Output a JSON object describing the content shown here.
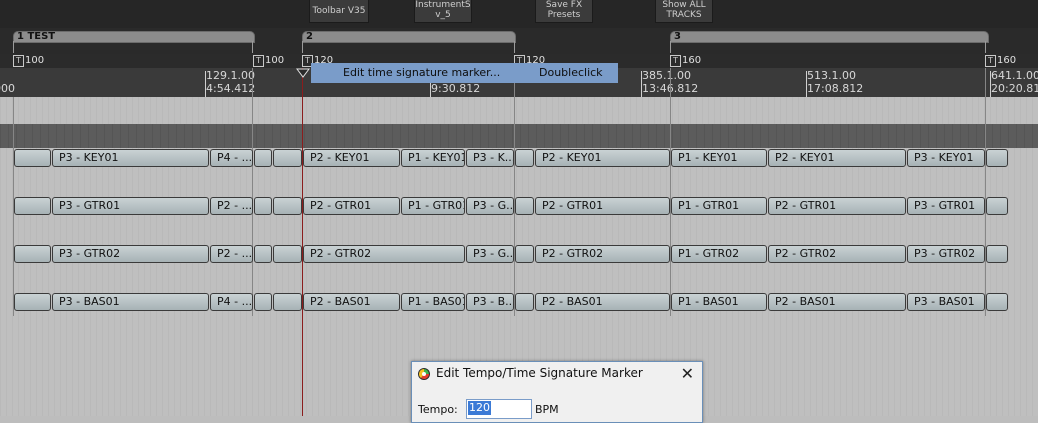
{
  "toolbar": {
    "buttons": [
      {
        "label": "Toolbar V35"
      },
      {
        "label": "InstrumentS v_5"
      },
      {
        "label": "Save FX Presets"
      },
      {
        "label": "Show ALL TRACKS"
      }
    ]
  },
  "regions": [
    {
      "label": "1 TEST"
    },
    {
      "label": "2"
    },
    {
      "label": "3"
    }
  ],
  "markers": [
    "100",
    "100",
    "120",
    "120",
    "160",
    "160"
  ],
  "ruler": [
    {
      "bar": "",
      "time": "000"
    },
    {
      "bar": "129.1.00",
      "time": "4:54.412"
    },
    {
      "bar": "",
      "time": "9:30.812"
    },
    {
      "bar": "385.1.00",
      "time": "13:46.812"
    },
    {
      "bar": "513.1.00",
      "time": "17:08.812"
    },
    {
      "bar": "641.1.00",
      "time": "20:20.812"
    }
  ],
  "tooltip": {
    "action": "Edit time signature marker...",
    "gesture": "Doubleclick"
  },
  "tracks": [
    {
      "items": [
        "",
        "P3 - KEY01",
        "P4 - ...",
        "",
        "",
        "P2 - KEY01",
        "P1 - KEY01",
        "P3 - K...",
        "",
        "P2 - KEY01",
        "P1 - KEY01",
        "P2 - KEY01",
        "P3 - KEY01",
        ""
      ]
    },
    {
      "items": [
        "",
        "P3 - GTR01",
        "P2 - ...",
        "",
        "",
        "P2 - GTR01",
        "P1 - GTR01",
        "P3 - G...",
        "",
        "P2 - GTR01",
        "P1 - GTR01",
        "P2 - GTR01",
        "P3 - GTR01",
        ""
      ]
    },
    {
      "items": [
        "",
        "P3 - GTR02",
        "P2 - ...",
        "",
        "",
        "P2 - GTR02",
        "",
        "P3 - G...",
        "",
        "P2 - GTR02",
        "P1 - GTR02",
        "P2 - GTR02",
        "P3 - GTR02",
        ""
      ]
    },
    {
      "items": [
        "",
        "P3 - BAS01",
        "P4 - ...",
        "",
        "",
        "P2 - BAS01",
        "P1 - BAS01",
        "P3 - B...",
        "",
        "P2 - BAS01",
        "P1 - BAS01",
        "P2 - BAS01",
        "P3 - BAS01",
        ""
      ]
    }
  ],
  "dialog": {
    "title": "Edit Tempo/Time Signature Marker",
    "close": "✕",
    "tempo_label": "Tempo:",
    "tempo_value": "120",
    "tempo_unit": "BPM"
  }
}
